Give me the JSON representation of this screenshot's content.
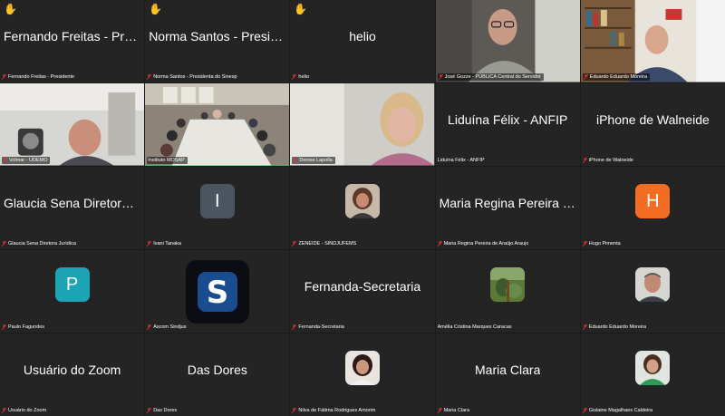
{
  "colors": {
    "tile_bg": "#242424",
    "active_border": "#2bd44b",
    "muted_icon": "#e02f2f",
    "avatar_slate": "#4a5560",
    "avatar_orange": "#f26d21",
    "avatar_teal": "#1ba4b4",
    "logo_blue": "#1a4d8f"
  },
  "tiles": [
    {
      "display_name": "Fernando Freitas - President…",
      "label": "Fernando Freitas - Presidente",
      "hand": true,
      "kind": "name"
    },
    {
      "display_name": "Norma Santos - Presidenta…",
      "label": "Norma Santos - Presidenta do Sinesp",
      "hand": true,
      "kind": "name"
    },
    {
      "display_name": "helio",
      "label": "helio",
      "hand": true,
      "kind": "name"
    },
    {
      "label": "José Gozze - PÚBLICA Central do Servidor",
      "kind": "video",
      "icon": "man-glasses-video"
    },
    {
      "label": "Eduardo Eduardo Moreira",
      "kind": "video",
      "icon": "man-bookshelf-video"
    },
    {
      "label": "Volmar - UDEMO",
      "kind": "video",
      "icon": "man-video"
    },
    {
      "label": "Instituto MOSAP",
      "kind": "video",
      "icon": "meeting-room-video",
      "active": true
    },
    {
      "label": "Denise Lapolla",
      "kind": "video",
      "icon": "woman-video"
    },
    {
      "display_name": "Liduína Félix - ANFIP",
      "label": "Liduína Félix - ANFIP",
      "kind": "name"
    },
    {
      "display_name": "iPhone de Walneide",
      "label": "iPhone de Walneide",
      "kind": "name"
    },
    {
      "display_name": "Glaucia Sena Diretora J…",
      "label": "Glaucia Sena Diretora Jurídica",
      "kind": "name"
    },
    {
      "avatar_letter": "I",
      "label": "Ivani Tanaka",
      "kind": "letter",
      "color": "#4a5560"
    },
    {
      "label": "ZENEIDE - SINDJUFEMS",
      "kind": "photo",
      "icon": "woman-photo-avatar"
    },
    {
      "display_name": "Maria Regina Pereira de…",
      "label": "Maria Regina Pereira de Araújo Araujo",
      "kind": "name"
    },
    {
      "avatar_letter": "H",
      "label": "Hugo Pimenta",
      "kind": "letter",
      "color": "#f26d21"
    },
    {
      "avatar_letter": "P",
      "label": "Paulo Fagundes",
      "kind": "letter",
      "color": "#1ba4b4"
    },
    {
      "label": "Ascom Sindjus",
      "kind": "logo",
      "icon": "s-logo-icon"
    },
    {
      "display_name": "Fernanda-Secretaria",
      "label": "Fernanda-Secretaria",
      "kind": "name"
    },
    {
      "label": "Amélia Cristina Marques Caracas",
      "kind": "photo",
      "icon": "nature-photo-avatar"
    },
    {
      "label": "Eduardo Eduardo Moreira",
      "kind": "photo",
      "icon": "man-photo-avatar"
    },
    {
      "display_name": "Usuário do Zoom",
      "label": "Usuário do Zoom",
      "kind": "name"
    },
    {
      "display_name": "Das Dores",
      "label": "Das Dores",
      "kind": "name"
    },
    {
      "label": "Nilva de Fátima Rodrigues Amorim",
      "kind": "photo",
      "icon": "woman-photo-avatar"
    },
    {
      "display_name": "Maria Clara",
      "label": "Maria Clara",
      "kind": "name"
    },
    {
      "label": "Gislaine Magalhaes Caldeira",
      "kind": "photo",
      "icon": "woman-green-photo-avatar"
    }
  ]
}
